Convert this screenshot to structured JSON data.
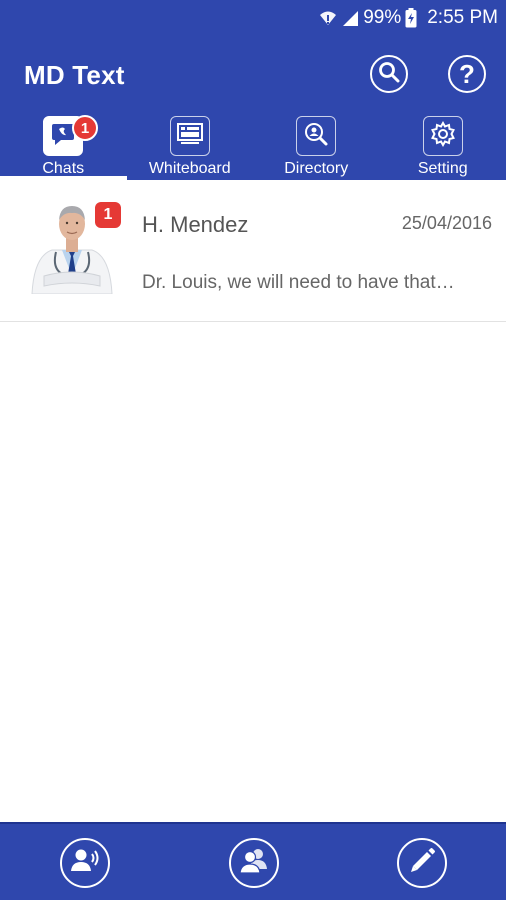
{
  "status_bar": {
    "battery": "99%",
    "time": "2:55 PM",
    "icons": [
      "wifi-icon",
      "signal-icon",
      "battery-charging-icon"
    ]
  },
  "app_bar": {
    "title": "MD Text",
    "actions": [
      "search-icon",
      "help-icon"
    ],
    "help_glyph": "?"
  },
  "tabs": [
    {
      "label": "Chats",
      "icon": "chat-icon",
      "active": true,
      "badge": "1"
    },
    {
      "label": "Whiteboard",
      "icon": "whiteboard-icon",
      "active": false
    },
    {
      "label": "Directory",
      "icon": "directory-search-icon",
      "active": false
    },
    {
      "label": "Setting",
      "icon": "gear-icon",
      "active": false
    }
  ],
  "chats": [
    {
      "name": "H. Mendez",
      "date": "25/04/2016",
      "preview": "Dr. Louis, we will need to have that…",
      "unread": "1",
      "avatar": "doctor-avatar"
    }
  ],
  "bottom_bar": {
    "actions": [
      "call-contact-icon",
      "group-contacts-icon",
      "compose-pencil-icon"
    ]
  },
  "colors": {
    "primary": "#2f47ad",
    "badge": "#e53935",
    "text_muted": "#666666"
  }
}
